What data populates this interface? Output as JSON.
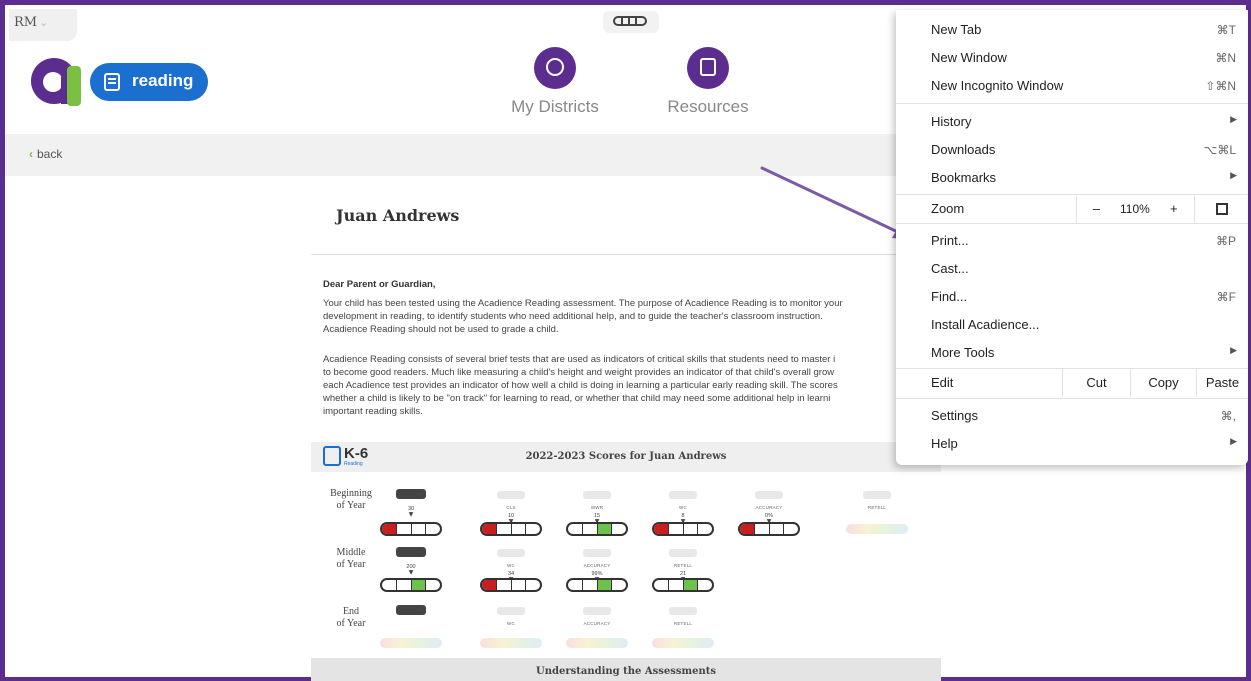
{
  "browser": {
    "profile_label": "RM",
    "menu": {
      "new_tab": {
        "label": "New Tab",
        "shortcut": "⌘T"
      },
      "new_window": {
        "label": "New Window",
        "shortcut": "⌘N"
      },
      "new_incognito": {
        "label": "New Incognito Window",
        "shortcut": "⇧⌘N"
      },
      "history": {
        "label": "History"
      },
      "downloads": {
        "label": "Downloads",
        "shortcut": "⌥⌘L"
      },
      "bookmarks": {
        "label": "Bookmarks"
      },
      "zoom": {
        "label": "Zoom",
        "minus": "–",
        "value": "110%",
        "plus": "+"
      },
      "print": {
        "label": "Print...",
        "shortcut": "⌘P"
      },
      "cast": {
        "label": "Cast..."
      },
      "find": {
        "label": "Find...",
        "shortcut": "⌘F"
      },
      "install": {
        "label": "Install Acadience..."
      },
      "more_tools": {
        "label": "More Tools"
      },
      "edit": {
        "label": "Edit",
        "cut": "Cut",
        "copy": "Copy",
        "paste": "Paste"
      },
      "settings": {
        "label": "Settings",
        "shortcut": "⌘,"
      },
      "help": {
        "label": "Help"
      }
    }
  },
  "app": {
    "product_label": "reading",
    "nav": [
      {
        "label": "My Districts",
        "icon": "districts-icon"
      },
      {
        "label": "Resources",
        "icon": "resources-icon"
      }
    ],
    "back_label": "back"
  },
  "report": {
    "student_name": "Juan Andrews",
    "salutation": "Dear Parent or Guardian,",
    "paragraph1": [
      "Your child has been tested using the Acadience Reading assessment. The purpose of Acadience Reading is to monitor your",
      "development in reading, to identify students who need additional help, and to guide the teacher's classroom instruction.",
      "Acadience Reading should not be used to grade a child."
    ],
    "paragraph2": [
      "Acadience Reading consists of several brief tests that are used as indicators of critical skills that students need to master i",
      "to become good readers. Much like measuring a child's height and weight provides an indicator of that child's overall grow",
      "each Acadience test provides an indicator of how well a child is doing in learning a particular early reading skill. The scores",
      "whether a child is likely to be \"on track\" for learning to read, or whether that child may need some additional help in learni",
      "important reading skills."
    ],
    "badge": {
      "title": "K-6",
      "sub": "Reading"
    },
    "scores_title": "2022-2023 Scores for Juan Andrews",
    "rows": [
      {
        "label_line1": "Beginning",
        "label_line2": "of Year"
      },
      {
        "label_line1": "Middle",
        "label_line2": "of Year"
      },
      {
        "label_line1": "End",
        "label_line2": "of Year"
      }
    ],
    "measures": {
      "boy": [
        {
          "tag": "BOY",
          "name": "",
          "score": "30",
          "level": "red"
        },
        {
          "tag": "NWF",
          "name": "CLS",
          "score": "10",
          "level": "red"
        },
        {
          "tag": "NWF",
          "name": "WWR",
          "score": "15",
          "level": "green"
        },
        {
          "tag": "ORF",
          "name": "WC",
          "score": "8",
          "level": "red"
        },
        {
          "tag": "ORF",
          "name": "ACCURACY",
          "score": "0%",
          "level": "red"
        },
        {
          "tag": "ORF",
          "name": "RETELL",
          "score": "",
          "level": "none"
        }
      ],
      "moy": [
        {
          "tag": "MOY",
          "name": "",
          "score": "200",
          "level": "green"
        },
        {
          "tag": "ORF",
          "name": "WC",
          "score": "34",
          "level": "red"
        },
        {
          "tag": "ORF",
          "name": "ACCURACY",
          "score": "99%",
          "level": "green"
        },
        {
          "tag": "ORF",
          "name": "RETELL",
          "score": "21",
          "level": "green"
        }
      ],
      "eoy": [
        {
          "tag": "EOY",
          "name": "",
          "score": "",
          "level": "none"
        },
        {
          "tag": "ORF",
          "name": "WC",
          "score": "",
          "level": "none"
        },
        {
          "tag": "ORF",
          "name": "ACCURACY",
          "score": "",
          "level": "none"
        },
        {
          "tag": "ORF",
          "name": "RETELL",
          "score": "",
          "level": "none"
        }
      ]
    },
    "understanding_title": "Understanding the Assessments"
  },
  "annotation": {
    "arrow_color": "#7b5aa6"
  },
  "colors": {
    "frame": "#5b2d8e",
    "accent_blue": "#1a6fcf",
    "green": "#7ac143",
    "red": "#c81e1e"
  }
}
